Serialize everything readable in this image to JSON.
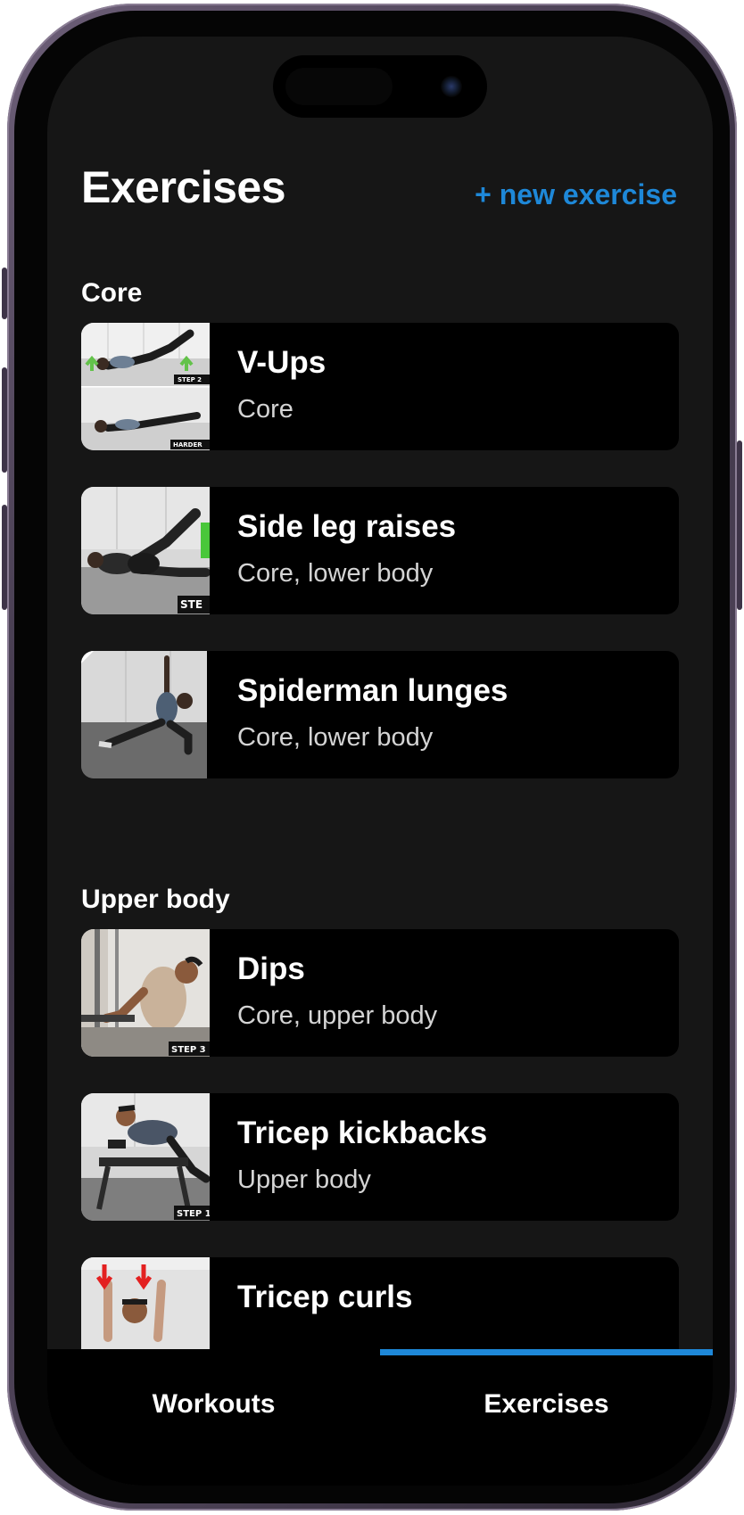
{
  "header": {
    "title": "Exercises",
    "new_exercise_label": "+ new exercise"
  },
  "sections": [
    {
      "title": "Core",
      "exercises": [
        {
          "name": "V-Ups",
          "tags": "Core",
          "thumb_caption": "STEP 2",
          "thumb_caption_2": "HARDER"
        },
        {
          "name": "Side leg raises",
          "tags": "Core, lower body",
          "thumb_caption": "STE"
        },
        {
          "name": "Spiderman lunges",
          "tags": "Core, lower body"
        }
      ]
    },
    {
      "title": "Upper body",
      "exercises": [
        {
          "name": "Dips",
          "tags": "Core, upper body",
          "thumb_caption": "STEP 3"
        },
        {
          "name": "Tricep kickbacks",
          "tags": "Upper body",
          "thumb_caption": "STEP 1"
        },
        {
          "name": "Tricep curls",
          "tags": ""
        }
      ]
    }
  ],
  "tabbar": {
    "tabs": [
      {
        "label": "Workouts",
        "active": false
      },
      {
        "label": "Exercises",
        "active": true
      }
    ]
  },
  "colors": {
    "accent": "#1e88d8",
    "background": "#161616",
    "card": "#000000",
    "text_primary": "#ffffff",
    "text_secondary": "#d4d4d4"
  }
}
